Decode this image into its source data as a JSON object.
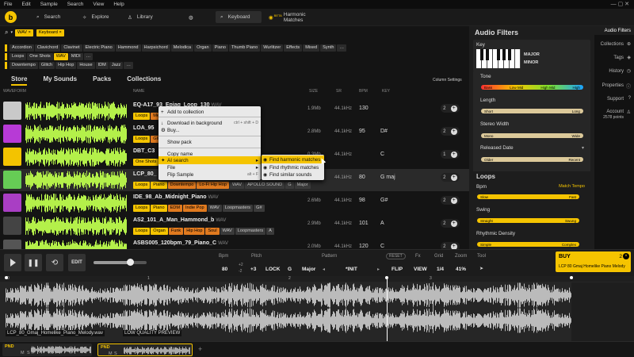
{
  "menu": [
    "File",
    "Edit",
    "Sample",
    "Search",
    "View",
    "Help"
  ],
  "topbar": {
    "search_label": "Search",
    "explore_label": "Explore",
    "library_label": "Library",
    "keyboard_label": "Keyboard",
    "harmonic_label": "Harmonic Matches",
    "harmonic_badge": "BETA"
  },
  "query": {
    "tags": [
      "WAV",
      "Keyboard"
    ]
  },
  "tag_rows": [
    [
      "Accordion",
      "Clavichord",
      "Clavinet",
      "Electric Piano",
      "Hammond",
      "Harpsichord",
      "Melodica",
      "Organ",
      "Piano",
      "Thumb Piano",
      "Wurlitzer",
      "Effects",
      "Mixed",
      "Synth"
    ],
    [
      "Loops",
      "One Shots",
      "WAV",
      "MIDI"
    ],
    [
      "Downtempo",
      "Glitch",
      "Hip Hop",
      "House",
      "IDM",
      "Jazz"
    ]
  ],
  "tabs": [
    "Store",
    "My Sounds",
    "Packs",
    "Collections"
  ],
  "column_settings": "Column Settings",
  "columns": {
    "waveform": "WAVEFORM",
    "name": "NAME",
    "size": "SIZE",
    "sr": "SR",
    "bpm": "BPM",
    "key": "KEY"
  },
  "rows": [
    {
      "name": "EQ-A17_93_Epiag_Loop_130",
      "ext": "WAV",
      "tags": [
        "Loops",
        "Mel"
      ],
      "size": "1.9Mb",
      "sr": "44.1kHz",
      "bpm": "130",
      "key": "",
      "count": "2",
      "thumb": "#c9c9c9"
    },
    {
      "name": "LOA_95",
      "ext": "",
      "tags": [
        "Loops",
        "Glit"
      ],
      "size": "2.8Mb",
      "sr": "44.1kHz",
      "bpm": "95",
      "key": "D#",
      "count": "2",
      "thumb": "#b73ad6"
    },
    {
      "name": "DBT_C3",
      "ext": "",
      "tags": [
        "One Shots",
        "E"
      ],
      "size": "0.3Mb",
      "sr": "44.1kHz",
      "bpm": "",
      "key": "C",
      "count": "1",
      "thumb": "#f3c300"
    },
    {
      "name": "LCP_80_",
      "ext": "",
      "tags": [
        "Loops",
        "Piano",
        "Downtempo",
        "Lo-Fi Hip Hop",
        "WAV",
        "APOLLO SOUND",
        "G",
        "Major"
      ],
      "size": "2.5Mb",
      "sr": "44.1kHz",
      "bpm": "80",
      "key": "G maj",
      "count": "2",
      "thumb": "#66cc55"
    },
    {
      "name": "IDE_98_Ab_Midnight_Piano",
      "ext": "WAV",
      "tags": [
        "Loops",
        "Piano",
        "EDM",
        "Indie Pop",
        "WAV",
        "Loopmasters",
        "G#"
      ],
      "size": "2.6Mb",
      "sr": "44.1kHz",
      "bpm": "98",
      "key": "G#",
      "count": "2",
      "thumb": "#a93ec4"
    },
    {
      "name": "AS2_101_A_Man_Hammond_b",
      "ext": "WAV",
      "tags": [
        "Loops",
        "Organ",
        "Funk",
        "Hip Hop",
        "Soul",
        "WAV",
        "Loopmasters",
        "A"
      ],
      "size": "2.9Mb",
      "sr": "44.1kHz",
      "bpm": "101",
      "key": "A",
      "count": "2",
      "thumb": "#444444"
    },
    {
      "name": "ASBS005_120bpm_79_Piano_C",
      "ext": "WAV",
      "tags": [],
      "size": "2.0Mb",
      "sr": "44.1kHz",
      "bpm": "120",
      "key": "C",
      "count": "2",
      "thumb": "#555555"
    }
  ],
  "context_menu": {
    "items": [
      "Add to collection",
      "Download in background",
      "Buy...",
      "Show pack",
      "Copy name",
      "AI search",
      "File",
      "Flip Sample"
    ],
    "shortcut_download": "ctrl + shift + D",
    "shortcut_flip": "alt + F",
    "submenu": [
      "Find harmonic matches",
      "Find rhythmic matches",
      "Find similar sounds"
    ]
  },
  "filters": {
    "title": "Audio Filters",
    "key_label": "Key",
    "major": "MAJOR",
    "minor": "MINOR",
    "tone_label": "Tone",
    "tone_bands": [
      "Bass",
      "Low Mid",
      "High Mid",
      "High"
    ],
    "length_label": "Length",
    "length_range": [
      "Short",
      "Long"
    ],
    "stereo_label": "Stereo Width",
    "stereo_range": [
      "Mono",
      "Wide"
    ],
    "released_label": "Released Date",
    "released_range": [
      "Older",
      "Recent"
    ],
    "loops_title": "Loops",
    "bpm_label": "Bpm",
    "match_tempo": "Match Tempo",
    "bpm_range": [
      "Slow",
      "Fast"
    ],
    "swing_label": "Swing",
    "swing_range": [
      "Straight",
      "Swung"
    ],
    "rhythmic_label": "Rhythmic Density",
    "rhythmic_range": [
      "Simple",
      "Complex"
    ]
  },
  "side_nav": {
    "items": [
      "Audio Filters",
      "Collections",
      "Tags",
      "History",
      "Properties",
      "Support",
      "Account"
    ],
    "points": "2578 points"
  },
  "transport": {
    "edit": "EDIT",
    "bpm_label": "Bpm",
    "bpm": "80",
    "pitch_label": "Pitch",
    "pitch": "+3",
    "pitch_up": "+2",
    "pitch_down": "-2",
    "lock": "LOCK",
    "key": "G",
    "mode": "Major",
    "pattern_label": "Pattern",
    "pattern": "*INIT",
    "reset": "RESET",
    "fx_label": "Fx",
    "flip": "FLIP",
    "grid_label": "Grid",
    "grid": "1/4",
    "zoom_label": "Zoom",
    "zoom": "41%",
    "view": "VIEW",
    "tool_label": "Tool"
  },
  "buy": {
    "label": "BUY",
    "count": "2",
    "item": "LCP 80 Gmaj Homelike Piano Melody"
  },
  "editor": {
    "ruler": [
      "0",
      "1",
      "2",
      "3",
      "4"
    ],
    "filename": "LCP_80_Gmaj_Homelike_Piano_Melody.wav",
    "quality": "LOW QUALITY PREVIEW"
  },
  "bottom": {
    "pnd": "PND",
    "m": "M",
    "s": "S",
    "add": "+"
  },
  "colors": {
    "accent": "#f5c400",
    "wave": "#b4f04a",
    "orange": "#e07a1f"
  }
}
